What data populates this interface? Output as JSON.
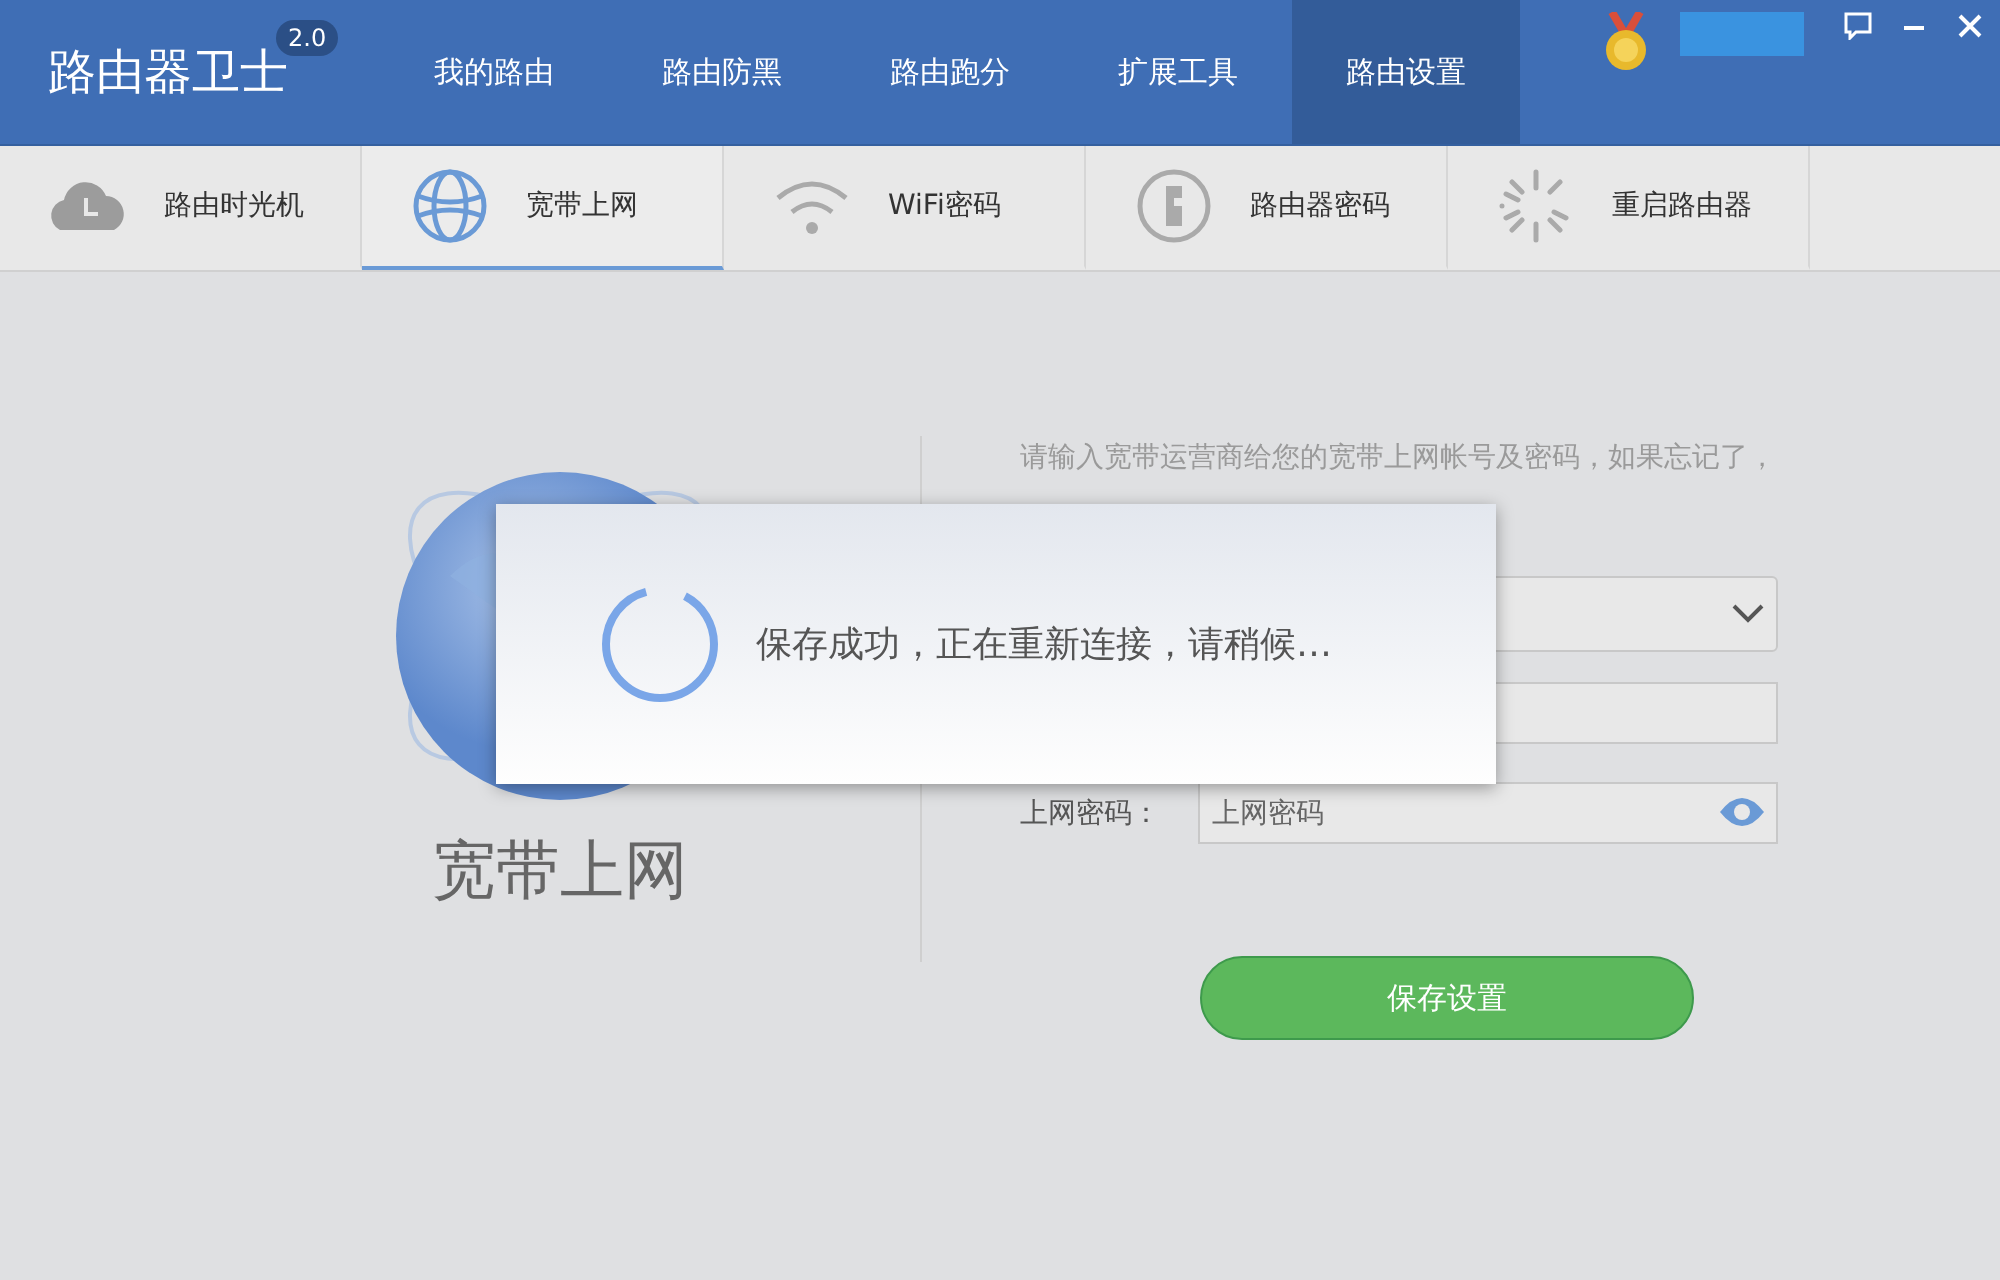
{
  "app": {
    "title": "路由器卫士",
    "version": "2.0"
  },
  "nav": [
    {
      "label": "我的路由",
      "selected": false
    },
    {
      "label": "路由防黑",
      "selected": false
    },
    {
      "label": "路由跑分",
      "selected": false
    },
    {
      "label": "扩展工具",
      "selected": false
    },
    {
      "label": "路由设置",
      "selected": true
    }
  ],
  "subnav": [
    {
      "kind": "time-machine",
      "label": "路由时光机",
      "selected": false
    },
    {
      "kind": "broadband",
      "label": "宽带上网",
      "selected": true
    },
    {
      "kind": "wifi",
      "label": "WiFi密码",
      "selected": false
    },
    {
      "kind": "password",
      "label": "路由器密码",
      "selected": false
    },
    {
      "kind": "restart",
      "label": "重启路由器",
      "selected": false
    }
  ],
  "panel": {
    "title": "宽带上网",
    "description": [
      "请输入宽带运营商给您的宽带上网帐号及密码，如果忘记了，"
    ],
    "fields": [
      {
        "kind": "select"
      },
      {
        "kind": "text"
      },
      {
        "kind": "password",
        "label": "上网密码：",
        "placeholder": "上网密码"
      }
    ],
    "save_button": "保存设置"
  },
  "dialog": {
    "message": "保存成功，正在重新连接，请稍候…"
  }
}
